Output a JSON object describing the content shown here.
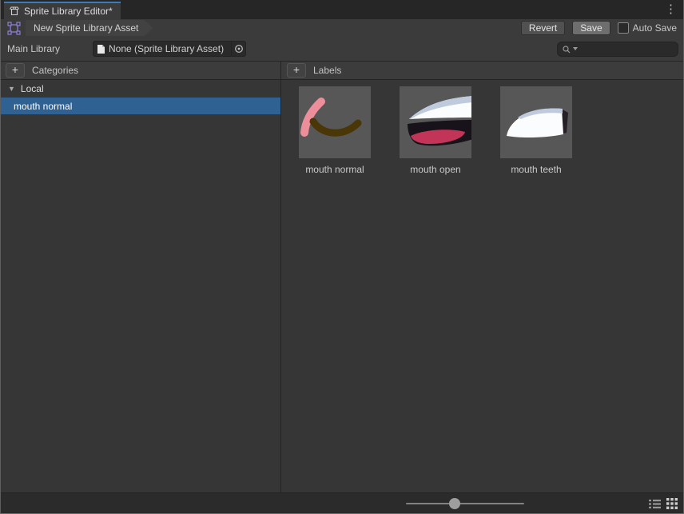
{
  "window": {
    "tab_title": "Sprite Library Editor*",
    "kebab_menu": "⋮"
  },
  "toolbar": {
    "breadcrumb": "New Sprite Library Asset",
    "revert_label": "Revert",
    "save_label": "Save",
    "auto_save_label": "Auto Save",
    "auto_save_checked": false
  },
  "main_library": {
    "label": "Main Library",
    "object_field_value": "None (Sprite Library Asset)",
    "search_value": "",
    "search_placeholder": ""
  },
  "categories_panel": {
    "header": "Categories",
    "add_button": "+",
    "foldout_arrow": "▼",
    "group_name": "Local",
    "items": [
      {
        "label": "mouth normal",
        "selected": true
      }
    ]
  },
  "labels_panel": {
    "header": "Labels",
    "add_button": "+",
    "items": [
      {
        "label": "mouth normal"
      },
      {
        "label": "mouth open"
      },
      {
        "label": "mouth teeth"
      }
    ]
  },
  "bottom_bar": {
    "slider_percent": 41,
    "icons": [
      "list-view-icon",
      "grid-view-icon"
    ]
  },
  "colors": {
    "selection_blue": "#2f6192",
    "tab_accent_blue": "#3d7dbb",
    "asset_icon_purple": "#8e7fd4",
    "sprite_pink": "#ed8e9b",
    "sprite_brown": "#4a3708",
    "sprite_crimson": "#c23558",
    "sprite_periwinkle": "#bfcbdd",
    "sprite_white": "#fbfcfd",
    "sprite_black": "#18131a"
  }
}
